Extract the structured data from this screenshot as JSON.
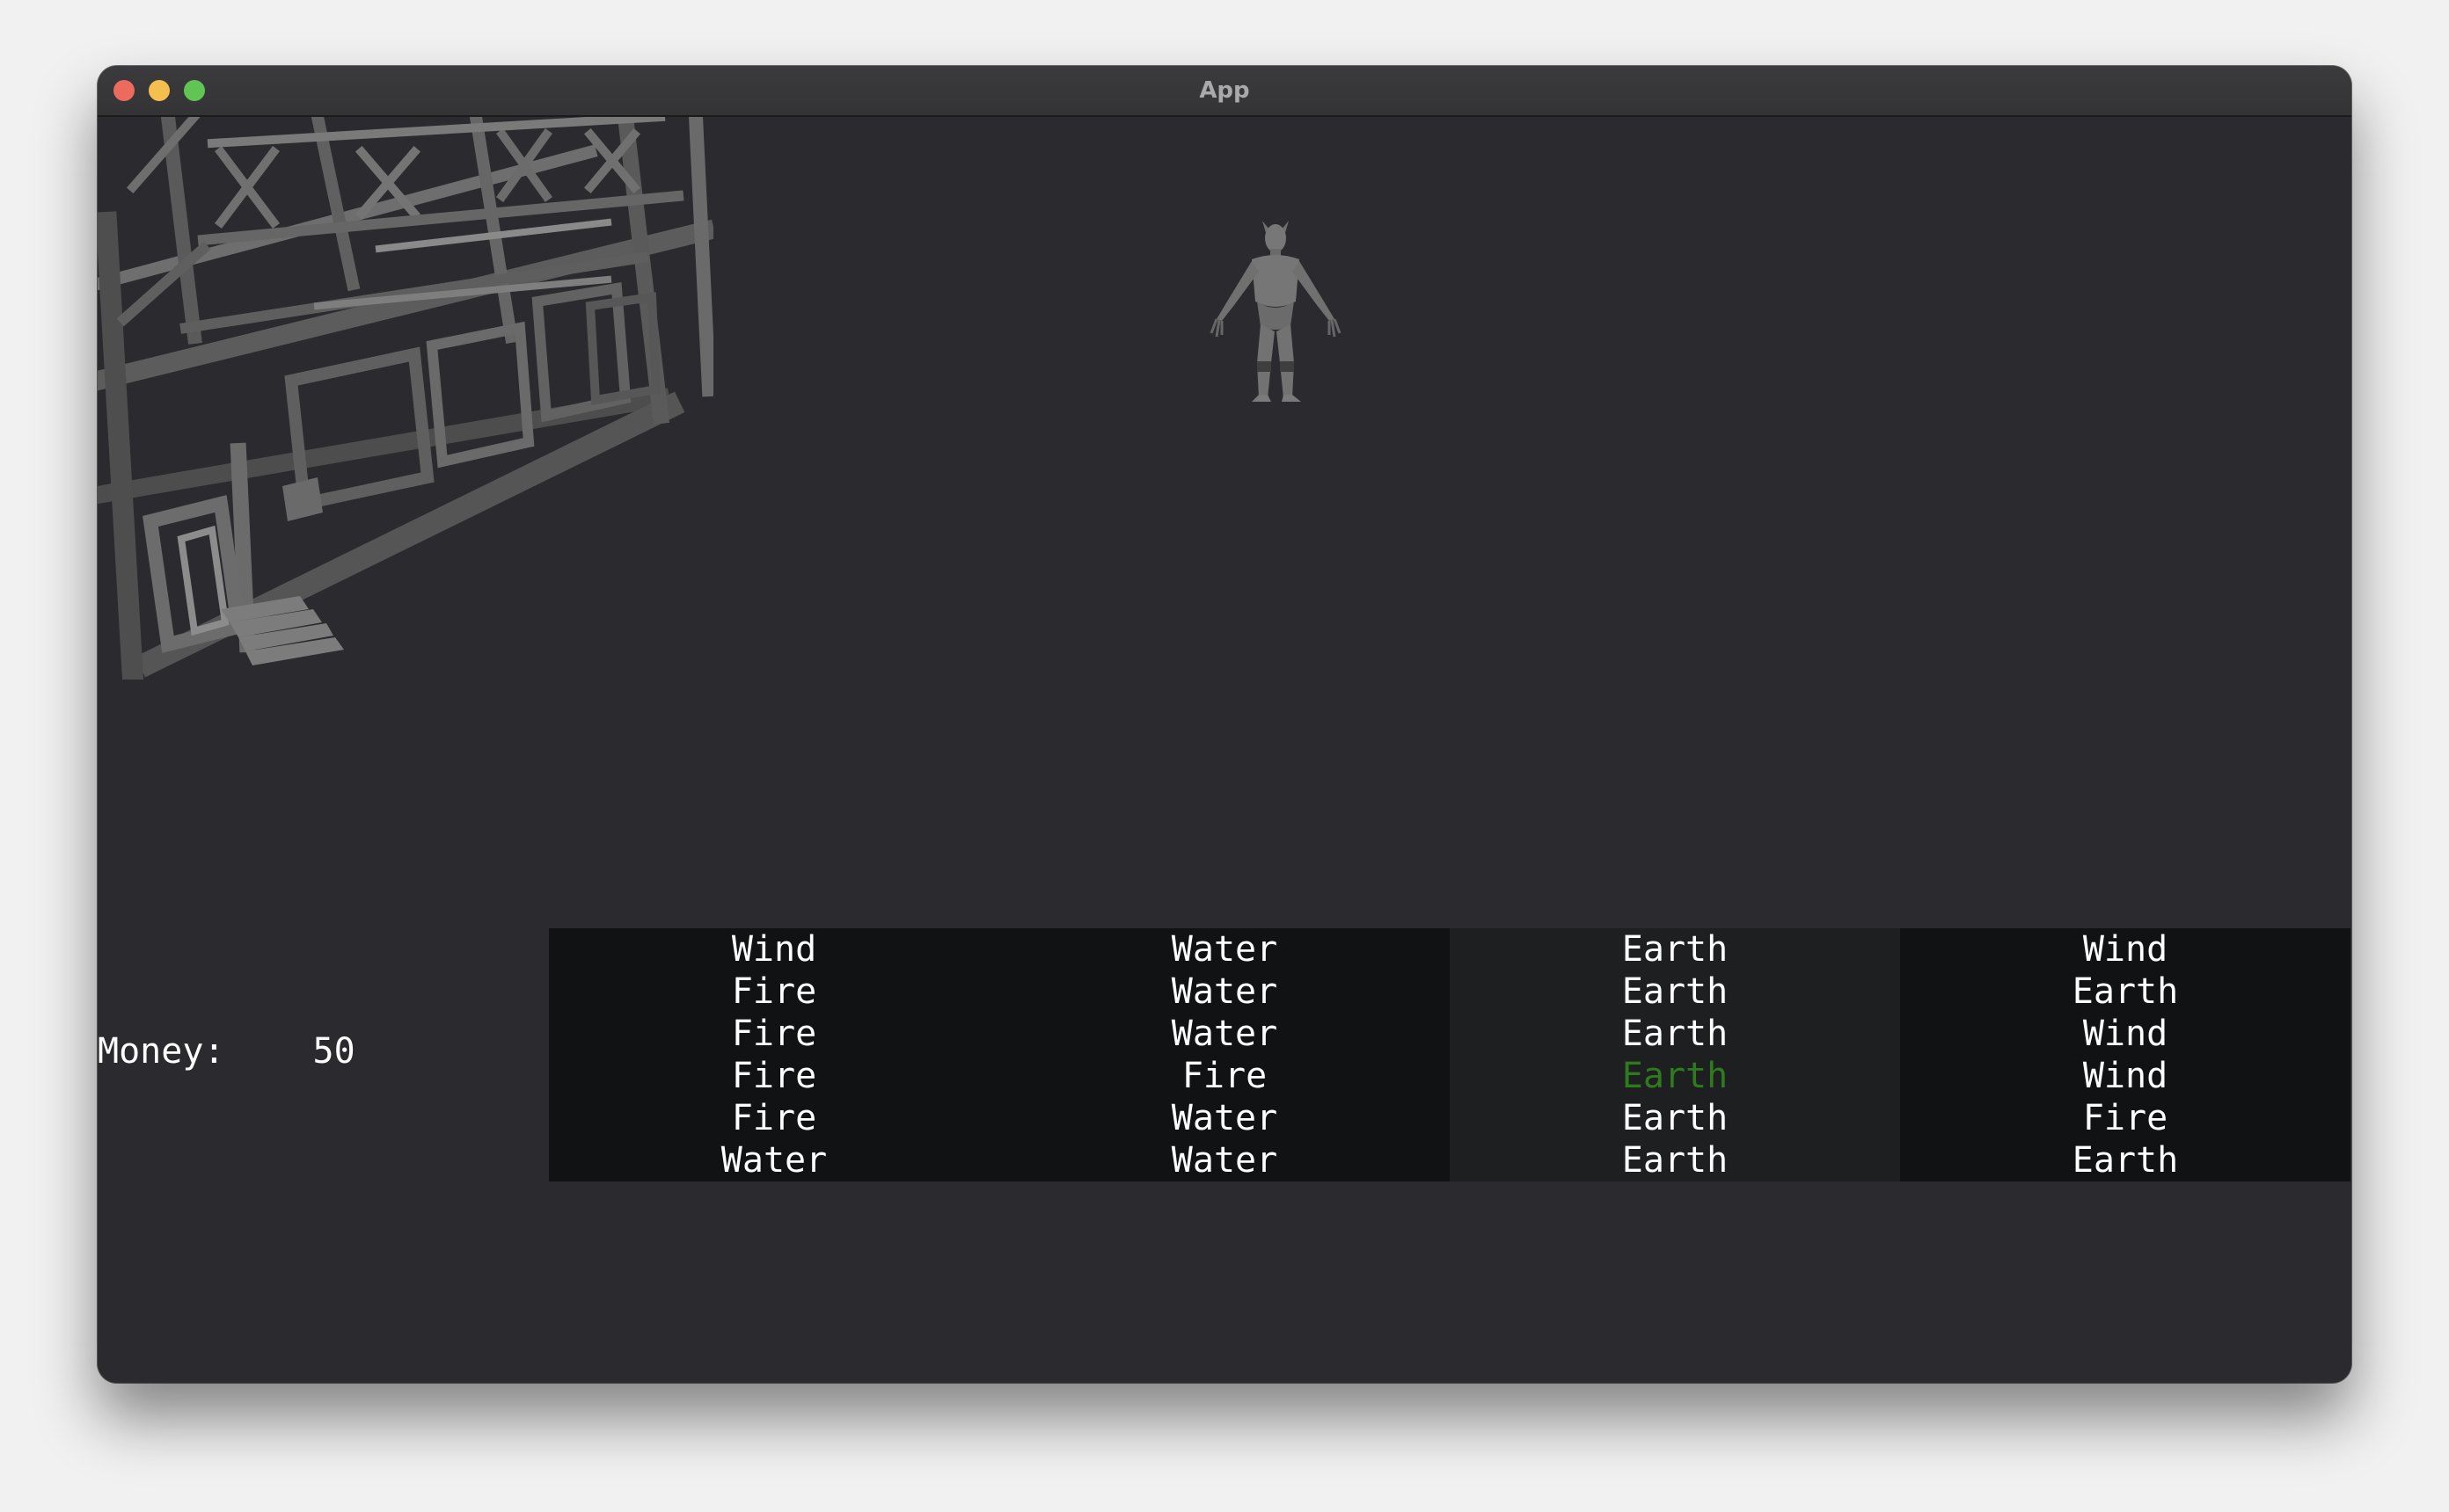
{
  "window": {
    "title": "App",
    "controls": {
      "close_color": "#ed6a5e",
      "minimize_color": "#f4bf4f",
      "maximize_color": "#61c554"
    }
  },
  "scene": {
    "objects": [
      "scaffold-structure",
      "humanoid-character"
    ]
  },
  "hud": {
    "money_label": "Money:",
    "money_value": "50"
  },
  "reels": [
    {
      "symbols": [
        "Wind",
        "Fire",
        "Fire",
        "Fire",
        "Fire",
        "Water"
      ]
    },
    {
      "symbols": [
        "Water",
        "Water",
        "Water",
        "Fire",
        "Water",
        "Water"
      ]
    },
    {
      "symbols": [
        "Earth",
        "Earth",
        "Earth",
        "Earth",
        "Earth",
        "Earth"
      ]
    },
    {
      "symbols": [
        "Wind",
        "Earth",
        "Wind",
        "Wind",
        "Fire",
        "Earth"
      ]
    }
  ],
  "highlight": {
    "reel": 3,
    "row": 4,
    "color": "#2f7a1e"
  }
}
